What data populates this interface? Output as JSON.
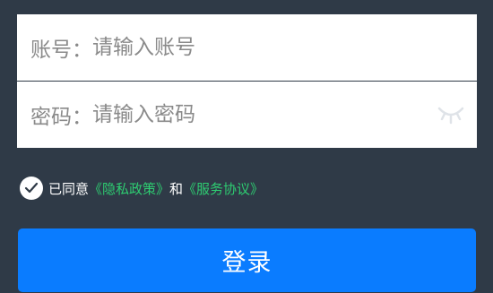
{
  "account": {
    "label": "账号：",
    "placeholder": "请输入账号",
    "value": ""
  },
  "password": {
    "label": "密码：",
    "placeholder": "请输入密码",
    "value": "",
    "toggle_icon": "eye-closed-icon"
  },
  "agreement": {
    "checked": true,
    "prefix": "已同意",
    "privacy_link": "《隐私政策》",
    "conjunction": "和",
    "terms_link": "《服务协议》",
    "check_icon": "checkmark-icon"
  },
  "login_button": {
    "label": "登录"
  },
  "colors": {
    "background": "#2f3a47",
    "primary": "#0a7cff",
    "link": "#2ecc71"
  }
}
